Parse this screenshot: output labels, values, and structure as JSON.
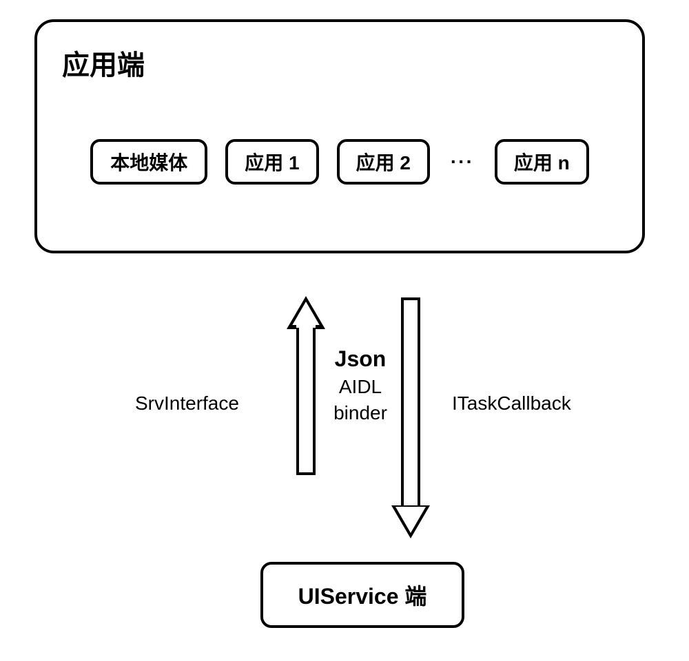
{
  "top": {
    "title": "应用端",
    "items": [
      "本地媒体",
      "应用 1",
      "应用 2",
      "应用 n"
    ],
    "ellipsis": "···"
  },
  "arrows": {
    "left_label": "SrvInterface",
    "center_top": "Json",
    "center_mid": "AIDL",
    "center_bot": "binder",
    "right_label": "ITaskCallback"
  },
  "bottom": {
    "label": "UIService 端"
  }
}
